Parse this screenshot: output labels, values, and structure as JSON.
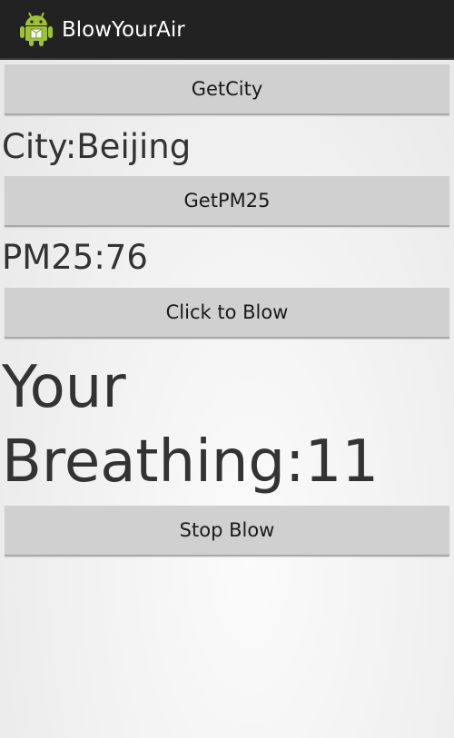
{
  "app": {
    "title": "BlowYourAir",
    "icon": "android-robot-icon",
    "icon_color": "#9fc037"
  },
  "main": {
    "get_city_button": "GetCity",
    "city_text": "City:Beijing",
    "get_pm25_button": "GetPM25",
    "pm25_text": "PM25:76",
    "click_to_blow_button": "Click to Blow",
    "breathing_text": "Your Breathing:11",
    "stop_blow_button": "Stop Blow"
  },
  "colors": {
    "action_bar": "#222222",
    "button_bg": "#d0d0d0",
    "text": "#333333"
  }
}
